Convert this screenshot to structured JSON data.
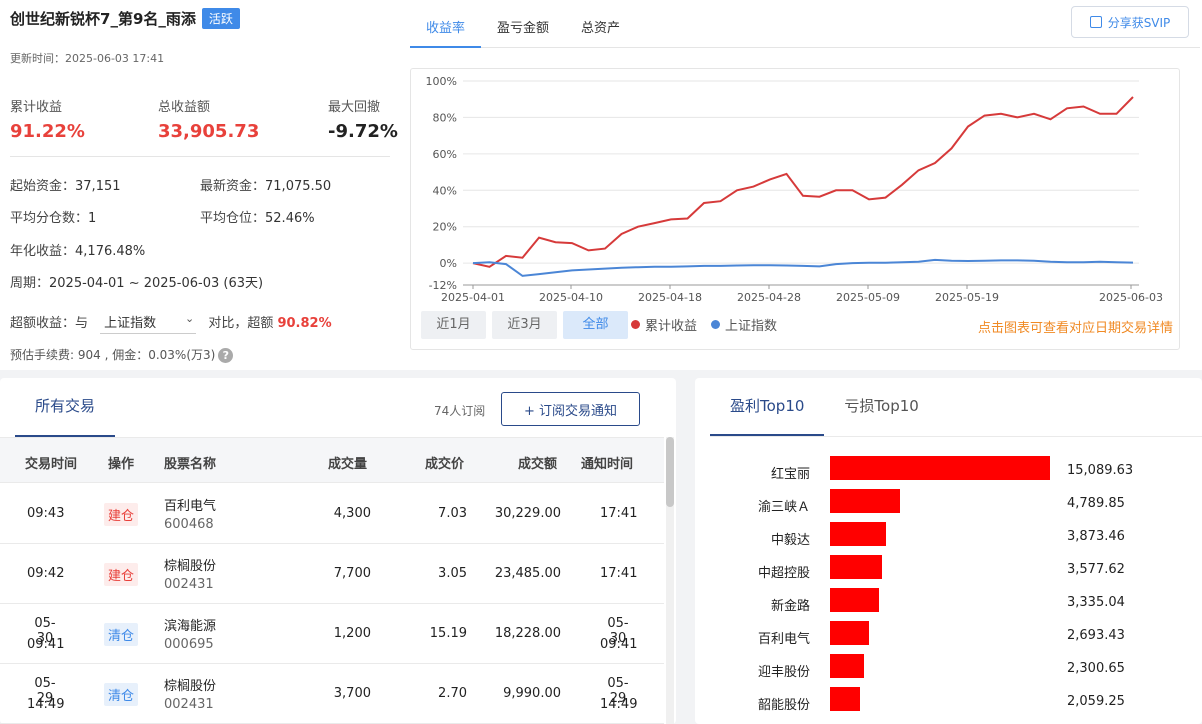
{
  "header": {
    "title": "创世纪新锐杯7_第9名_雨添",
    "badge": "活跃",
    "update_label": "更新时间：",
    "update_time": "2025-06-03 17:41"
  },
  "stats": [
    {
      "label": "累计收益",
      "value": "91.22%"
    },
    {
      "label": "总收益额",
      "value": "33,905.73"
    },
    {
      "label": "最大回撤",
      "value": "-9.72%"
    }
  ],
  "info": {
    "start_capital_label": "起始资金：",
    "start_capital": "37,151",
    "latest_capital_label": "最新资金：",
    "latest_capital": "71,075.50",
    "avg_split_label": "平均分仓数：",
    "avg_split": "1",
    "avg_position_label": "平均仓位：",
    "avg_position": "52.46%",
    "annual_label": "年化收益：",
    "annual": "4,176.48%",
    "period_label": "周期：",
    "period": "2025-04-01 ~ 2025-06-03 (63天)",
    "excess_label": "超额收益：",
    "excess_with": "与",
    "excess_index": "上证指数",
    "excess_compare": "对比，超额",
    "excess_value": "90.82%",
    "fee_text": "预估手续费: 904 , 佣金：0.03%(万3)"
  },
  "chart_tabs": [
    "收益率",
    "盈亏金额",
    "总资产"
  ],
  "share_label": "分享获SVIP",
  "range_buttons": [
    "近1月",
    "近3月",
    "全部"
  ],
  "legend": [
    {
      "name": "累计收益",
      "color": "#d63a3a"
    },
    {
      "name": "上证指数",
      "color": "#4b86d6"
    }
  ],
  "hint": "点击图表可查看对应日期交易详情",
  "chart_data": {
    "type": "line",
    "x_tick_labels": [
      "2025-04-01",
      "2025-04-10",
      "2025-04-18",
      "2025-04-28",
      "2025-05-09",
      "2025-05-19",
      "2025-06-03"
    ],
    "y_tick_labels": [
      "100%",
      "80%",
      "60%",
      "40%",
      "20%",
      "0%",
      "-12%"
    ],
    "ylim": [
      -12,
      100
    ],
    "grid": true,
    "series": [
      {
        "name": "累计收益",
        "color": "#d63a3a",
        "values": [
          0,
          -2,
          4,
          3,
          14,
          11.5,
          11,
          7,
          8,
          16,
          20,
          22,
          24,
          24.5,
          33,
          34,
          40,
          42,
          46,
          49,
          37,
          36.5,
          40,
          40,
          35,
          36,
          43,
          51,
          55,
          63,
          75,
          81,
          82,
          80,
          82,
          79,
          85,
          86,
          82,
          82,
          91.22
        ]
      },
      {
        "name": "上证指数",
        "color": "#4b86d6",
        "values": [
          0,
          0.5,
          -0.5,
          -7,
          -6,
          -5,
          -4,
          -3.5,
          -3,
          -2.5,
          -2.2,
          -2,
          -2,
          -1.8,
          -1.5,
          -1.5,
          -1.3,
          -1.2,
          -1.2,
          -1.3,
          -1.5,
          -1.8,
          -0.5,
          0,
          0.2,
          0.2,
          0.5,
          0.8,
          1.8,
          1.3,
          1.2,
          1.3,
          1.5,
          1.5,
          1.3,
          0.8,
          0.5,
          0.5,
          0.8,
          0.5,
          0.3
        ]
      }
    ]
  },
  "trades": {
    "tab_label": "所有交易",
    "subscribers": "74人订阅",
    "subscribe_label": "+ 订阅交易通知",
    "columns": [
      "交易时间",
      "操作",
      "股票名称",
      "成交量",
      "成交价",
      "成交额",
      "通知时间"
    ],
    "rows": [
      {
        "time1": "09:43",
        "time2": "",
        "op": "建仓",
        "op_type": "build",
        "name": "百利电气",
        "code": "600468",
        "qty": "4,300",
        "price": "7.03",
        "amount": "30,229.00",
        "notify1": "17:41",
        "notify2": ""
      },
      {
        "time1": "09:42",
        "time2": "",
        "op": "建仓",
        "op_type": "build",
        "name": "棕榈股份",
        "code": "002431",
        "qty": "7,700",
        "price": "3.05",
        "amount": "23,485.00",
        "notify1": "17:41",
        "notify2": ""
      },
      {
        "time1": "05-30",
        "time2": "09:41",
        "op": "清仓",
        "op_type": "clear",
        "name": "滨海能源",
        "code": "000695",
        "qty": "1,200",
        "price": "15.19",
        "amount": "18,228.00",
        "notify1": "05-30",
        "notify2": "09:41"
      },
      {
        "time1": "05-29",
        "time2": "14:49",
        "op": "清仓",
        "op_type": "clear",
        "name": "棕榈股份",
        "code": "002431",
        "qty": "3,700",
        "price": "2.70",
        "amount": "9,990.00",
        "notify1": "05-29",
        "notify2": "14:49"
      }
    ]
  },
  "top10": {
    "tabs": [
      "盈利Top10",
      "亏损Top10"
    ],
    "bar_color": "#ff0000",
    "items": [
      {
        "name": "红宝丽",
        "value": "15,089.63",
        "num": 15089.63
      },
      {
        "name": "渝三峡Ａ",
        "value": "4,789.85",
        "num": 4789.85
      },
      {
        "name": "中毅达",
        "value": "3,873.46",
        "num": 3873.46
      },
      {
        "name": "中超控股",
        "value": "3,577.62",
        "num": 3577.62
      },
      {
        "name": "新金路",
        "value": "3,335.04",
        "num": 3335.04
      },
      {
        "name": "百利电气",
        "value": "2,693.43",
        "num": 2693.43
      },
      {
        "name": "迎丰股份",
        "value": "2,300.65",
        "num": 2300.65
      },
      {
        "name": "韶能股份",
        "value": "2,059.25",
        "num": 2059.25
      }
    ]
  }
}
